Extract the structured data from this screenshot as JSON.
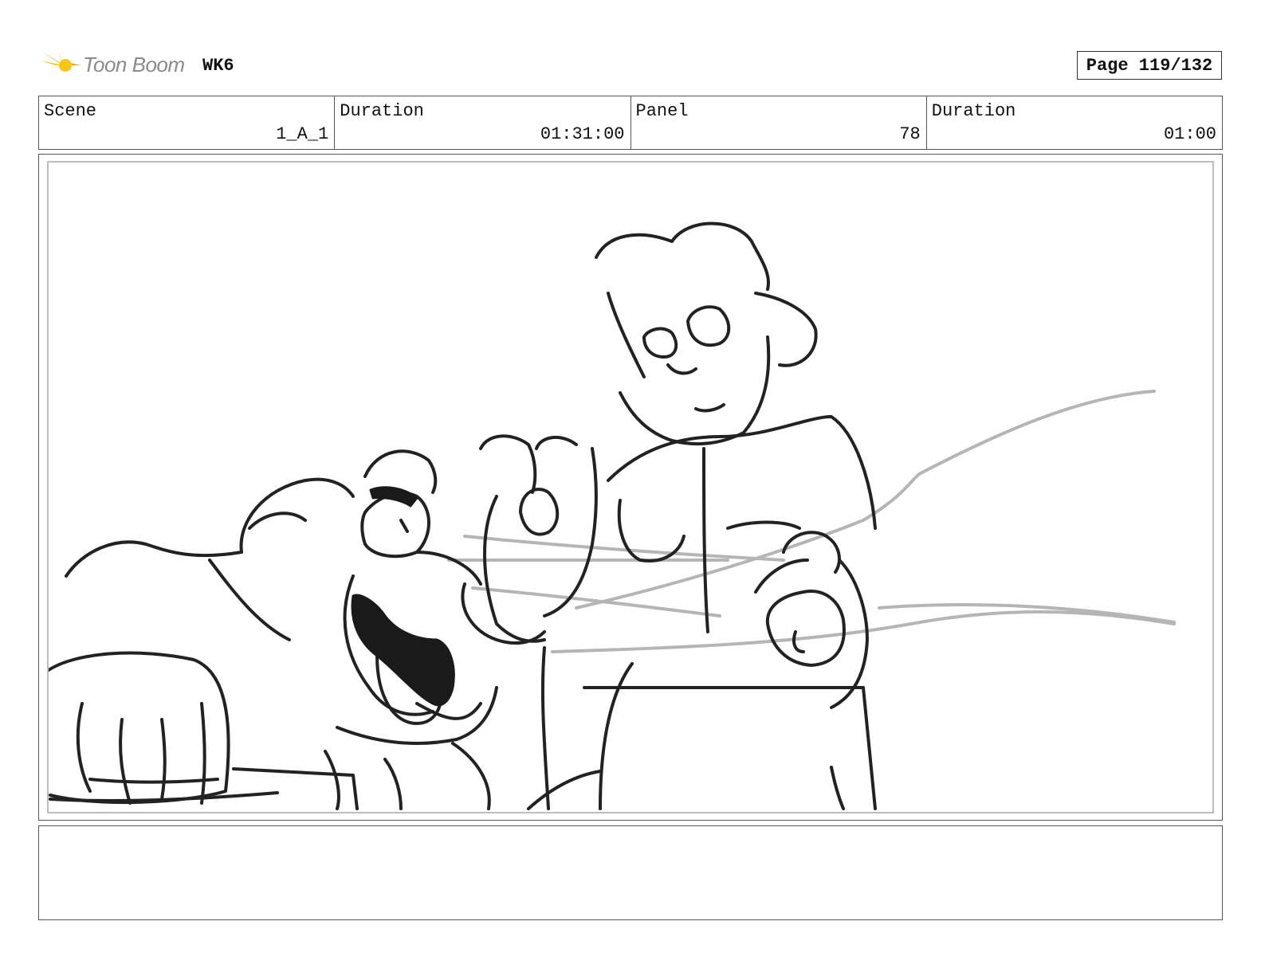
{
  "header": {
    "logo_text": "Toon Boom",
    "project": "WK6",
    "page": "Page 119/132"
  },
  "info": {
    "scene_label": "Scene",
    "scene_value": "1_A_1",
    "scene_duration_label": "Duration",
    "scene_duration_value": "01:31:00",
    "panel_label": "Panel",
    "panel_value": "78",
    "panel_duration_label": "Duration",
    "panel_duration_value": "01:00"
  },
  "notes": {
    "text": ""
  },
  "colors": {
    "logo_accent": "#f2b705",
    "ink": "#222222",
    "pencil": "#b5b5b5",
    "border": "#555555"
  }
}
